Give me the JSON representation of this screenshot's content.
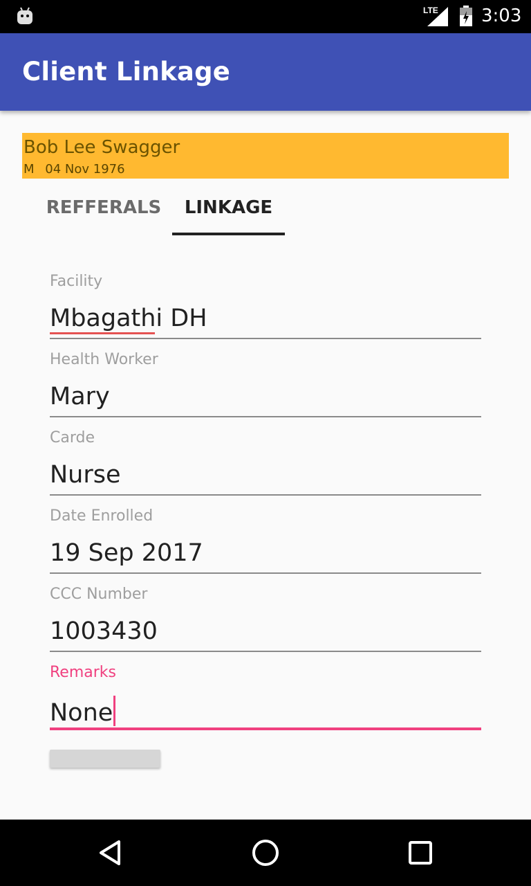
{
  "status_bar": {
    "network": "LTE",
    "time": "3:03",
    "icons": [
      "android-icon",
      "signal-icon",
      "battery-icon"
    ]
  },
  "app_bar": {
    "title": "Client Linkage",
    "color": "#3f51b5"
  },
  "client": {
    "name": "Bob Lee Swagger",
    "sex": "M",
    "dob": "04 Nov 1976",
    "banner_color": "#ffb930"
  },
  "tabs": [
    {
      "label": "REFFERALS",
      "selected": false
    },
    {
      "label": "LINKAGE",
      "selected": true
    }
  ],
  "form": {
    "facility": {
      "label": "Facility",
      "value": "Mbagathi DH"
    },
    "health_worker": {
      "label": "Health Worker",
      "value": "Mary"
    },
    "carde": {
      "label": "Carde",
      "value": "Nurse"
    },
    "date_enrolled": {
      "label": "Date Enrolled",
      "value": "19 Sep 2017"
    },
    "ccc_number": {
      "label": "CCC Number",
      "value": "1003430"
    },
    "remarks": {
      "label": "Remarks",
      "value": "None",
      "focused": true
    }
  },
  "accent_color": "#f0407f",
  "nav_bar": {
    "buttons": [
      "back-icon",
      "home-icon",
      "recents-icon"
    ]
  }
}
